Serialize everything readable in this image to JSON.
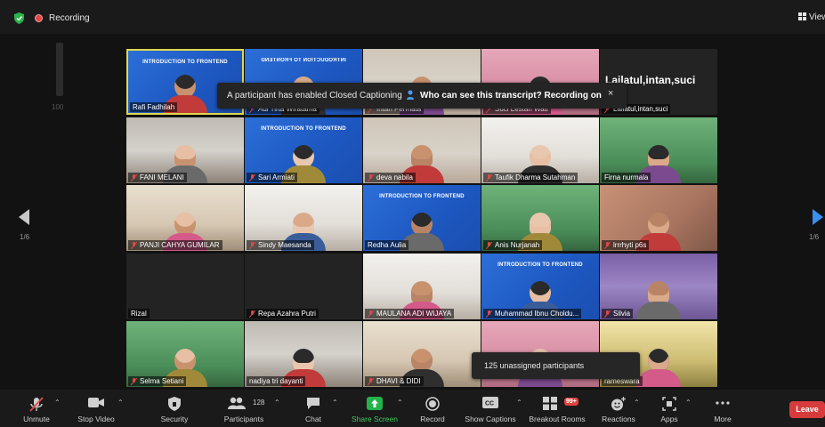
{
  "topbar": {
    "recording_label": "Recording",
    "view_label": "View"
  },
  "volume_label": "100",
  "toast": {
    "message": "A participant has enabled Closed Captioning",
    "link": "Who can see this transcript? Recording on",
    "close": "×"
  },
  "pagination": {
    "prev_page": "1/6",
    "next_page": "1/6"
  },
  "tiles": [
    {
      "name": "Rafi Fadhilah",
      "muted": false,
      "bg": "slide",
      "slide": "INTRODUCTION TO FRONTEND",
      "active": true
    },
    {
      "name": "Adi Tirta Wiratama",
      "muted": true,
      "bg": "slide",
      "slide": "INTRODUCTION TO FRONTEND",
      "flip": true
    },
    {
      "name": "Intan Permata",
      "muted": true,
      "bg": "room"
    },
    {
      "name": "Suci Lestari Wati",
      "muted": true,
      "bg": "pink"
    },
    {
      "name": "Lailatul,intan,suci",
      "muted": true,
      "bg": "dark",
      "big": "Lailatul,intan,suci"
    },
    {
      "name": "FANI MELANI",
      "muted": true,
      "bg": "wall"
    },
    {
      "name": "Sari Armiati",
      "muted": true,
      "bg": "slide",
      "slide": "INTRODUCTION TO FRONTEND"
    },
    {
      "name": "deva nabila",
      "muted": true,
      "bg": "room"
    },
    {
      "name": "Taufik Dharma Sutahman",
      "muted": true,
      "bg": "white"
    },
    {
      "name": "Firna nurmala",
      "muted": false,
      "bg": "green"
    },
    {
      "name": "PANJI CAHYA GUMILAR",
      "muted": true,
      "bg": "room2"
    },
    {
      "name": "Sindy Maesanda",
      "muted": true,
      "bg": "white"
    },
    {
      "name": "Redha Aulia",
      "muted": false,
      "bg": "slide",
      "slide": "INTRODUCTION TO FRONTEND"
    },
    {
      "name": "Anis Nurjanah",
      "muted": true,
      "bg": "green"
    },
    {
      "name": "lrrrhyti p6s",
      "muted": true,
      "bg": "skin"
    },
    {
      "name": "Rizal",
      "muted": false,
      "bg": "dark"
    },
    {
      "name": "Repa Azahra Putri",
      "muted": true,
      "bg": "dark"
    },
    {
      "name": "MAULANA ADI WIJAYA",
      "muted": true,
      "bg": "white"
    },
    {
      "name": "Muhammad Ibnu Choldu...",
      "muted": true,
      "bg": "slide",
      "slide": "INTRODUCTION TO FRONTEND"
    },
    {
      "name": "Silvia",
      "muted": true,
      "bg": "purple"
    },
    {
      "name": "Selma Setiani",
      "muted": true,
      "bg": "green"
    },
    {
      "name": "nadiya tri dayanti",
      "muted": false,
      "bg": "wall"
    },
    {
      "name": "DHAVI & DIDI",
      "muted": true,
      "bg": "room2"
    },
    {
      "name": "",
      "muted": false,
      "bg": "pink"
    },
    {
      "name": "rameswara",
      "muted": false,
      "bg": "yellow"
    }
  ],
  "popover": {
    "text": "125 unassigned participants"
  },
  "toolbar": {
    "unmute": "Unmute",
    "stop_video": "Stop Video",
    "security": "Security",
    "participants": "Participants",
    "participants_count": "128",
    "chat": "Chat",
    "share_screen": "Share Screen",
    "record": "Record",
    "show_captions": "Show Captions",
    "breakout_rooms": "Breakout Rooms",
    "breakout_badge": "99+",
    "reactions": "Reactions",
    "apps": "Apps",
    "more": "More",
    "leave": "Leave"
  },
  "colors": {
    "accent_green": "#24b24a",
    "leave_red": "#d73b3b",
    "active_speaker": "#e1d84a",
    "slide_blue": "#2c6fd8"
  }
}
